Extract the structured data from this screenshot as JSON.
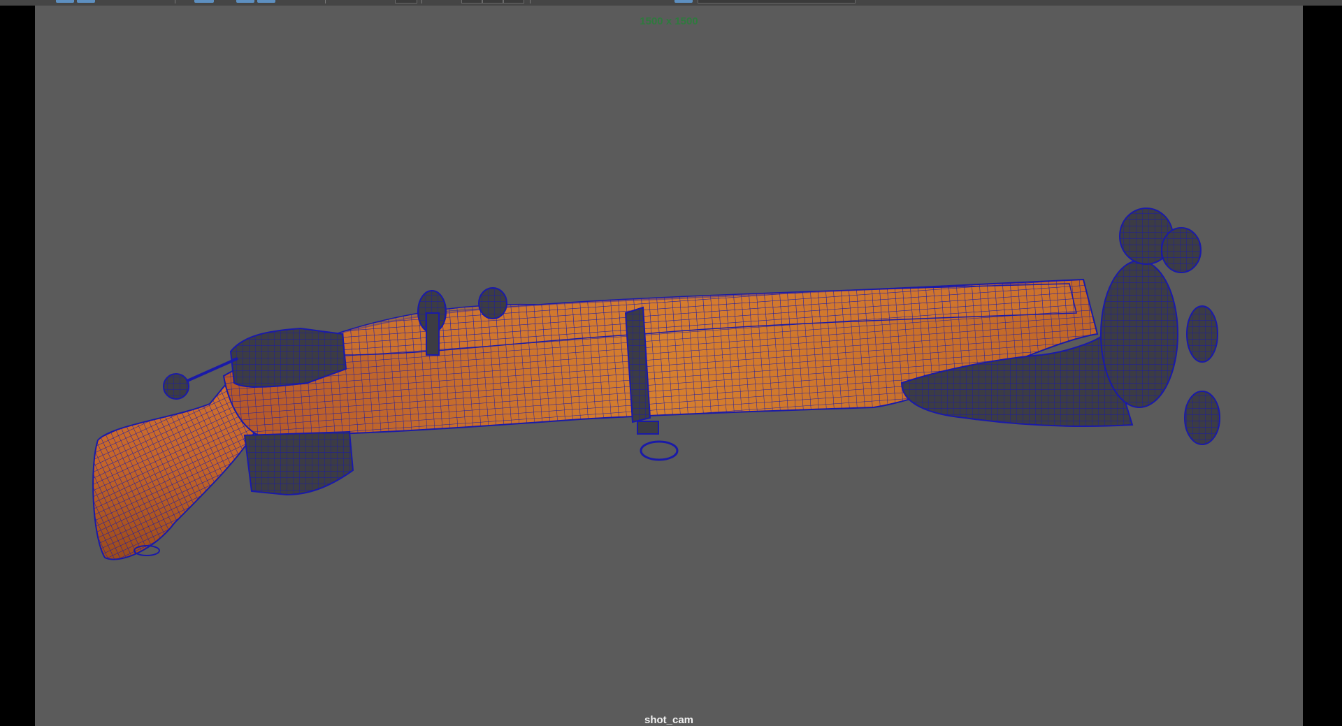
{
  "viewport": {
    "resolution_gate_label": "1500 x 1500",
    "camera_name": "shot_cam"
  },
  "model": {
    "icon": "rifle-wireframe-on-shaded",
    "wireframe_color": "#1a1aa8",
    "wood_color": "#c4652a",
    "wood_dark_color": "#8a3f16",
    "metal_color": "#3c3c44"
  },
  "colors": {
    "viewport_background": "#5b5b5b",
    "resolution_label": "#2f7a3e",
    "camera_label": "#f2f2f2",
    "letterbox": "#000000"
  }
}
